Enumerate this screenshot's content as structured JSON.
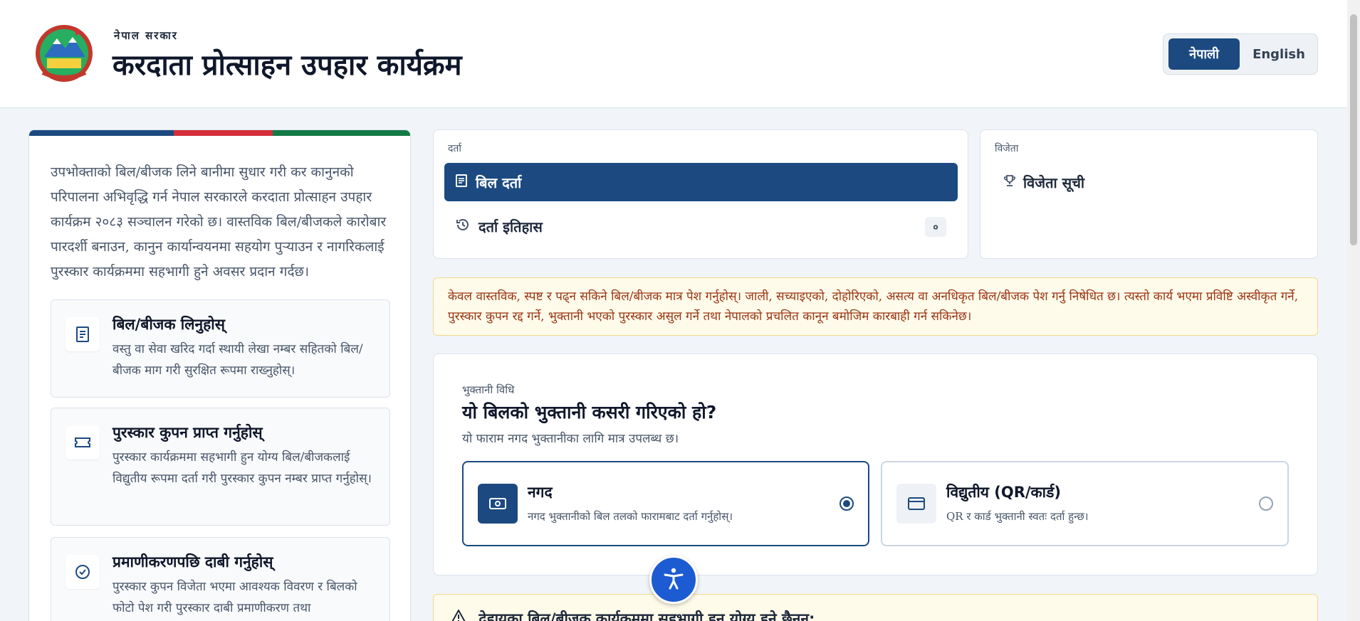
{
  "header": {
    "gov_label": "नेपाल सरकार",
    "title": "करदाता प्रोत्साहन उपहार कार्यक्रम",
    "lang_nepali": "नेपाली",
    "lang_english": "English"
  },
  "left": {
    "intro": "उपभोक्ताको बिल/बीजक लिने बानीमा सुधार गरी कर कानुनको परिपालना अभिवृद्धि गर्न नेपाल सरकारले करदाता प्रोत्साहन उपहार कार्यक्रम २०८३ सञ्चालन गरेको छ। वास्तविक बिल/बीजकले कारोबार पारदर्शी बनाउन, कानुन कार्यान्वयनमा सहयोग पुर्‍याउन र नागरिकलाई पुरस्कार कार्यक्रममा सहभागी हुने अवसर प्रदान गर्दछ।",
    "steps": [
      {
        "title": "बिल/बीजक लिनुहोस्",
        "desc": "वस्तु वा सेवा खरिद गर्दा स्थायी लेखा नम्बर सहितको बिल/बीजक माग गरी सुरक्षित रूपमा राख्नुहोस्।"
      },
      {
        "title": "पुरस्कार कुपन प्राप्त गर्नुहोस्",
        "desc": "पुरस्कार कार्यक्रममा सहभागी हुन योग्य बिल/बीजकलाई विद्युतीय रूपमा दर्ता गरी पुरस्कार कुपन नम्बर प्राप्त गर्नुहोस्।"
      },
      {
        "title": "प्रमाणीकरणपछि दाबी गर्नुहोस्",
        "desc": "पुरस्कार कुपन विजेता भएमा आवश्यक विवरण र बिलको फोटो पेश गरी पुरस्कार दाबी प्रमाणीकरण तथा"
      }
    ]
  },
  "registration": {
    "label": "दर्ता",
    "bill_register": "बिल दर्ता",
    "history": "दर्ता इतिहास",
    "history_count": "०"
  },
  "winners": {
    "label": "विजेता",
    "list": "विजेता सूची"
  },
  "notice": "केवल वास्तविक, स्पष्ट र पढ्न सकिने बिल/बीजक मात्र पेश गर्नुहोस्। जाली, सच्याइएको, दोहोरिएको, असत्य वा अनधिकृत बिल/बीजक पेश गर्नु निषेधित छ। त्यस्तो कार्य भएमा प्रविष्टि अस्वीकृत गर्ने, पुरस्कार कुपन रद्द गर्ने, भुक्तानी भएको पुरस्कार असुल गर्ने तथा नेपालको प्रचलित कानून बमोजिम कारबाही गर्न सकिनेछ।",
  "payment": {
    "label": "भुक्तानी विधि",
    "question": "यो बिलको भुक्तानी कसरी गरिएको हो?",
    "subtitle": "यो फाराम नगद भुक्तानीका लागि मात्र उपलब्ध छ।",
    "cash": {
      "title": "नगद",
      "desc": "नगद भुक्तानीको बिल तलको फारामबाट दर्ता गर्नुहोस्।"
    },
    "electronic": {
      "title": "विद्युतीय (QR/कार्ड)",
      "desc": "QR र कार्ड भुक्तानी स्वतः दर्ता हुन्छ।"
    },
    "selected": "cash"
  },
  "warning": "देहायका बिल/बीजक कार्यक्रममा सहभागी हुन योग्य हुने छैनन्:",
  "colors": {
    "primary": "#1c4a80",
    "red": "#d42e3a",
    "green": "#137a46",
    "accessibility": "#1d5bd2"
  }
}
